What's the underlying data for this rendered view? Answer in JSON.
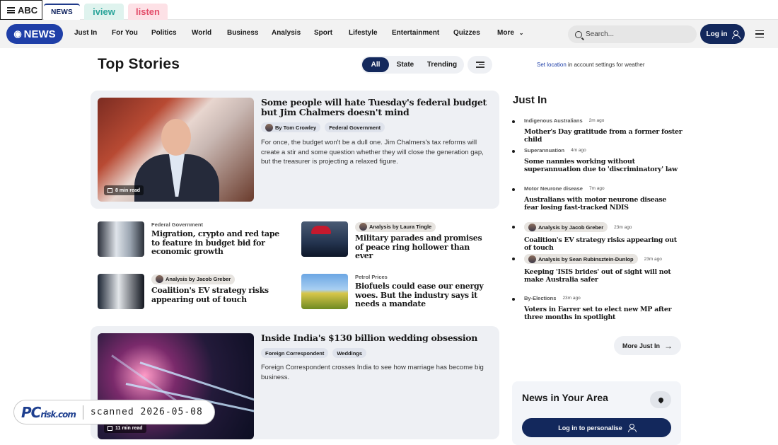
{
  "abc_bar": {
    "logo": "ABC",
    "tabs": [
      "NEWS",
      "iview",
      "listen"
    ]
  },
  "nav": {
    "logo": "NEWS",
    "items": [
      "Just In",
      "For You",
      "Politics",
      "World",
      "Business",
      "Analysis",
      "Sport",
      "Lifestyle",
      "Entertainment",
      "Quizzes",
      "More"
    ],
    "search_placeholder": "Search...",
    "login": "Log in"
  },
  "top_stories": {
    "title": "Top Stories",
    "filters": [
      "All",
      "State",
      "Trending"
    ],
    "location_link": "Set location",
    "location_note": " in account settings for weather"
  },
  "lead": {
    "title": "Some people will hate Tuesday's federal budget but Jim Chalmers doesn't mind",
    "author": "By Tom Crowley",
    "tag": "Federal Government",
    "body": "For once, the budget won't be a dull one. Jim Chalmers's tax reforms will create a stir and some question whether they will close the generation gap, but the treasurer is projecting a relaxed figure.",
    "read_time": "8 min read"
  },
  "small_stories": [
    {
      "topic": "Federal Government",
      "title": "Migration, crypto and red tape to feature in budget bid for economic growth"
    },
    {
      "topic": "Analysis by Laura Tingle",
      "title": "Military parades and promises of peace ring hollower than ever"
    },
    {
      "topic": "Analysis by Jacob Greber",
      "title": "Coalition's EV strategy risks appearing out of touch"
    },
    {
      "topic": "Petrol Prices",
      "title": "Biofuels could ease our energy woes. But the industry says it needs a mandate"
    }
  ],
  "feature": {
    "title": "Inside India's $130 billion wedding obsession",
    "tags": [
      "Foreign Correspondent",
      "Weddings"
    ],
    "body": "Foreign Correspondent crosses India to see how marriage has become big business.",
    "read_time": "11 min read"
  },
  "just_in": {
    "title": "Just In",
    "items": [
      {
        "topic": "Indigenous Australians",
        "time": "2m ago",
        "headline": "Mother's Day gratitude from a former foster child"
      },
      {
        "topic": "Superannuation",
        "time": "4m ago",
        "headline": "Some nannies working without superannuation due to 'discriminatory' law"
      },
      {
        "topic": "Motor Neurone disease",
        "time": "7m ago",
        "headline": "Australians with motor neurone disease fear losing fast-tracked NDIS"
      },
      {
        "topic": "Analysis by Jacob Greber",
        "time": "23m ago",
        "headline": "Coalition's EV strategy risks appearing out of touch"
      },
      {
        "topic": "Analysis by Sean Rubinsztein-Dunlop",
        "time": "23m ago",
        "headline": "Keeping 'ISIS brides' out of sight will not make Australia safer"
      },
      {
        "topic": "By-Elections",
        "time": "23m ago",
        "headline": "Voters in Farrer set to elect new MP after three months in spotlight"
      }
    ],
    "more_button": "More Just In"
  },
  "news_area": {
    "title": "News in Your Area",
    "button": "Log in to personalise"
  },
  "watermark": {
    "logo": "PC",
    "logo_suffix": "risk.com",
    "text": "scanned 2026-05-08"
  }
}
